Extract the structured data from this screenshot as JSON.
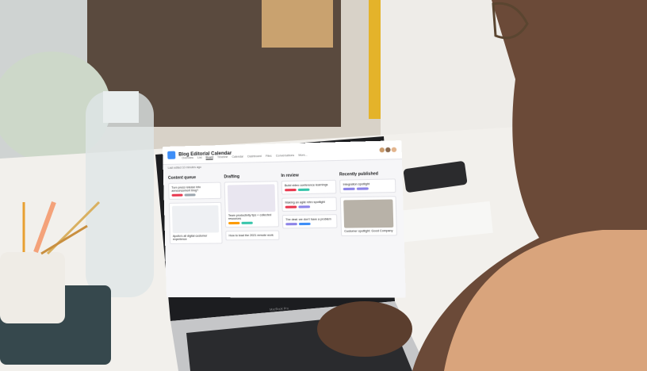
{
  "app": {
    "project_title": "Blog Editorial Calendar",
    "nav": [
      "Overview",
      "List",
      "Board",
      "Timeline",
      "Calendar",
      "Dashboard",
      "Files",
      "Conversations",
      "More..."
    ],
    "active_nav": "Board",
    "subbar_text": "Last edited 10 minutes ago"
  },
  "board": {
    "columns": [
      {
        "title": "Content queue",
        "cards": [
          {
            "title": "Turn press release into announcement blog?"
          },
          {
            "title": "Apollo's all digital customer experience"
          }
        ]
      },
      {
        "title": "Drafting",
        "cards": [
          {
            "title": "Team productivity tips + collected resources"
          },
          {
            "title": "How to lead the 2021 remote work"
          }
        ]
      },
      {
        "title": "In review",
        "cards": [
          {
            "title": "Build video conference learnings"
          },
          {
            "title": "Making an agile retro spotlight"
          },
          {
            "title": "The deal: we don't have a problem"
          }
        ]
      },
      {
        "title": "Recently published",
        "cards": [
          {
            "title": "Integration spotlight"
          },
          {
            "title": "Customer spotlight: Good Company"
          }
        ]
      }
    ]
  },
  "colors": {
    "tag_red": "#e8384f",
    "tag_green": "#37c5ab",
    "tag_purple": "#8d84e8",
    "tag_orange": "#fd9a00",
    "brand_blue": "#3e8ef7"
  },
  "laptop_brand": "MacBook Pro"
}
